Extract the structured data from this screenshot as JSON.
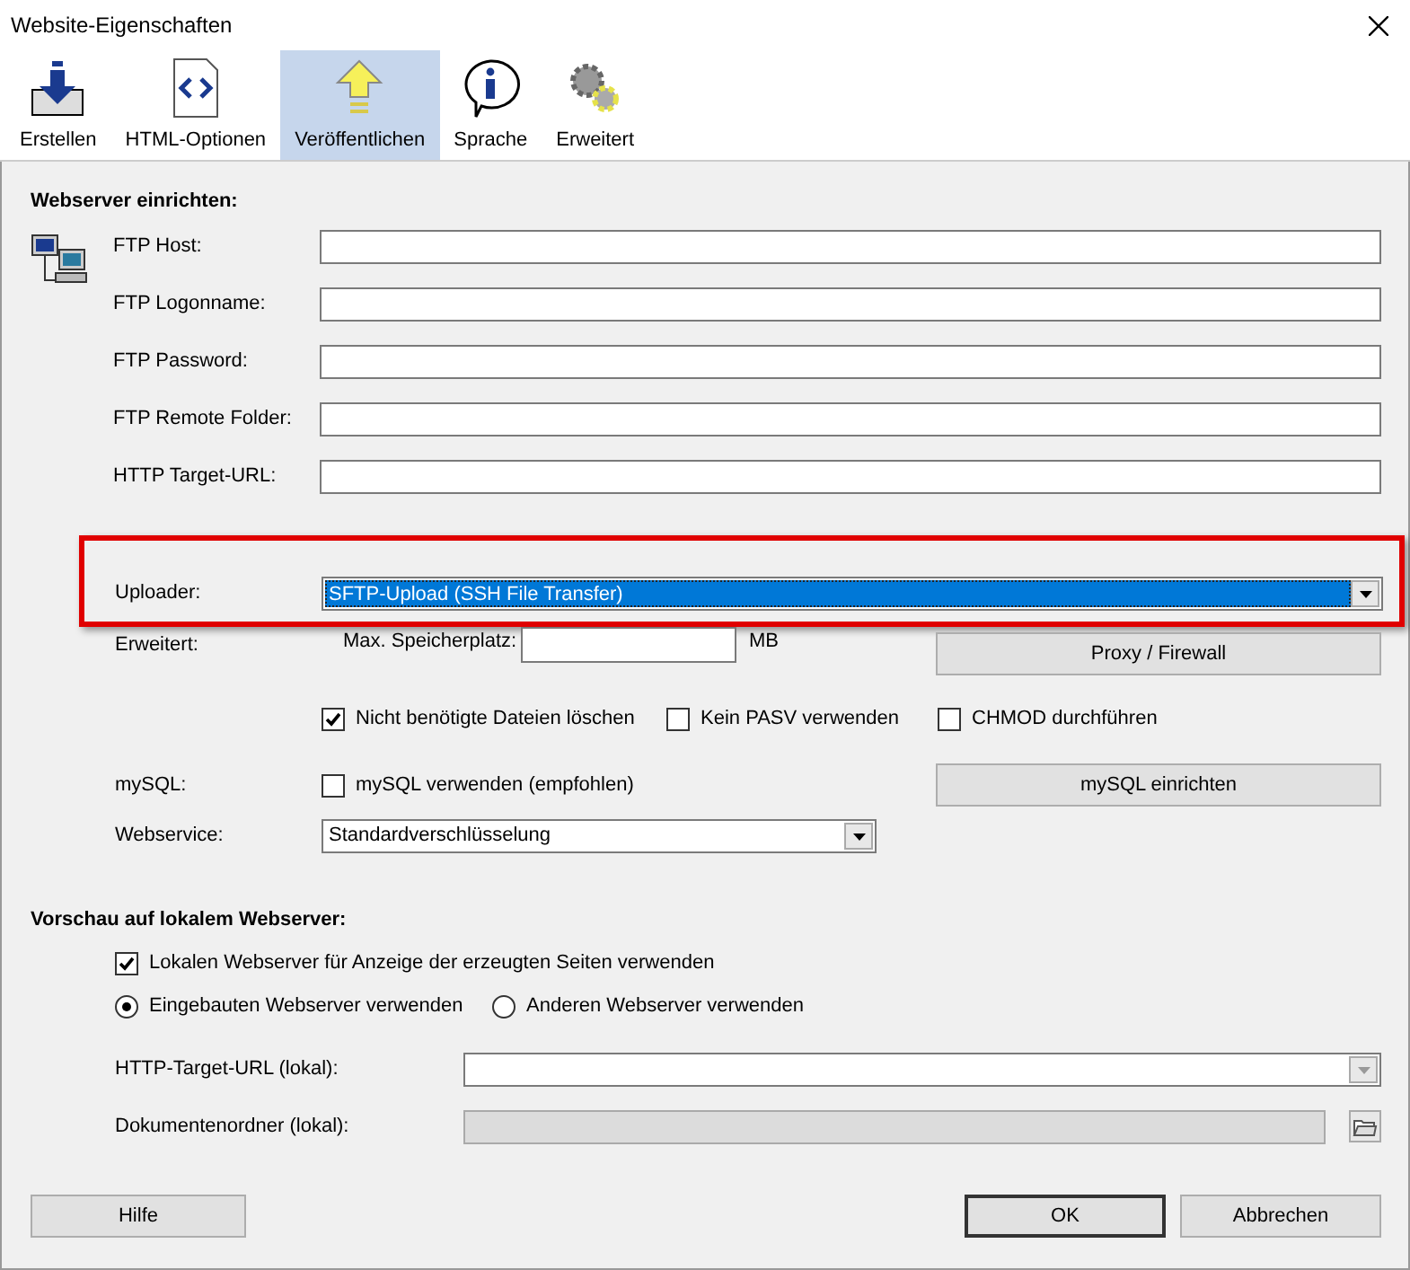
{
  "window": {
    "title": "Website-Eigenschaften"
  },
  "tabs": [
    {
      "label": "Erstellen",
      "selected": false
    },
    {
      "label": "HTML-Optionen",
      "selected": false
    },
    {
      "label": "Veröffentlichen",
      "selected": true
    },
    {
      "label": "Sprache",
      "selected": false
    },
    {
      "label": "Erweitert",
      "selected": false
    }
  ],
  "webserver": {
    "heading": "Webserver einrichten:",
    "fields": [
      {
        "label": "FTP Host:"
      },
      {
        "label": "FTP Logonname:"
      },
      {
        "label": "FTP Password:"
      },
      {
        "label": "FTP Remote Folder:"
      },
      {
        "label": "HTTP Target-URL:"
      }
    ],
    "uploader": {
      "label": "Uploader:",
      "value": "SFTP-Upload (SSH File Transfer)",
      "highlighted": true
    },
    "advanced": {
      "label": "Erweitert:",
      "storage_label": "Max. Speicherplatz:",
      "storage_unit": "MB",
      "proxy_button": "Proxy / Firewall"
    },
    "options": [
      {
        "label": "Nicht benötigte Dateien löschen",
        "checked": true
      },
      {
        "label": "Kein PASV verwenden",
        "checked": false
      },
      {
        "label": "CHMOD durchführen",
        "checked": false
      }
    ],
    "mysql": {
      "label": "mySQL:",
      "checkbox": {
        "label": "mySQL verwenden (empfohlen)",
        "checked": false
      },
      "button": "mySQL einrichten"
    },
    "webservice": {
      "label": "Webservice:",
      "value": "Standardverschlüsselung"
    }
  },
  "preview": {
    "heading": "Vorschau auf lokalem Webserver:",
    "use_local": {
      "label": "Lokalen Webserver für Anzeige der erzeugten Seiten verwenden",
      "checked": true
    },
    "servers": [
      {
        "label": "Eingebauten Webserver verwenden",
        "selected": true
      },
      {
        "label": "Anderen Webserver verwenden",
        "selected": false
      }
    ],
    "target_url": {
      "label": "HTTP-Target-URL (lokal):"
    },
    "document_folder": {
      "label": "Dokumentenordner (lokal):",
      "disabled": true
    }
  },
  "buttons": [
    {
      "label": "Hilfe",
      "default": false
    },
    {
      "label": "OK",
      "default": true
    },
    {
      "label": "Abbrechen",
      "default": false
    }
  ]
}
